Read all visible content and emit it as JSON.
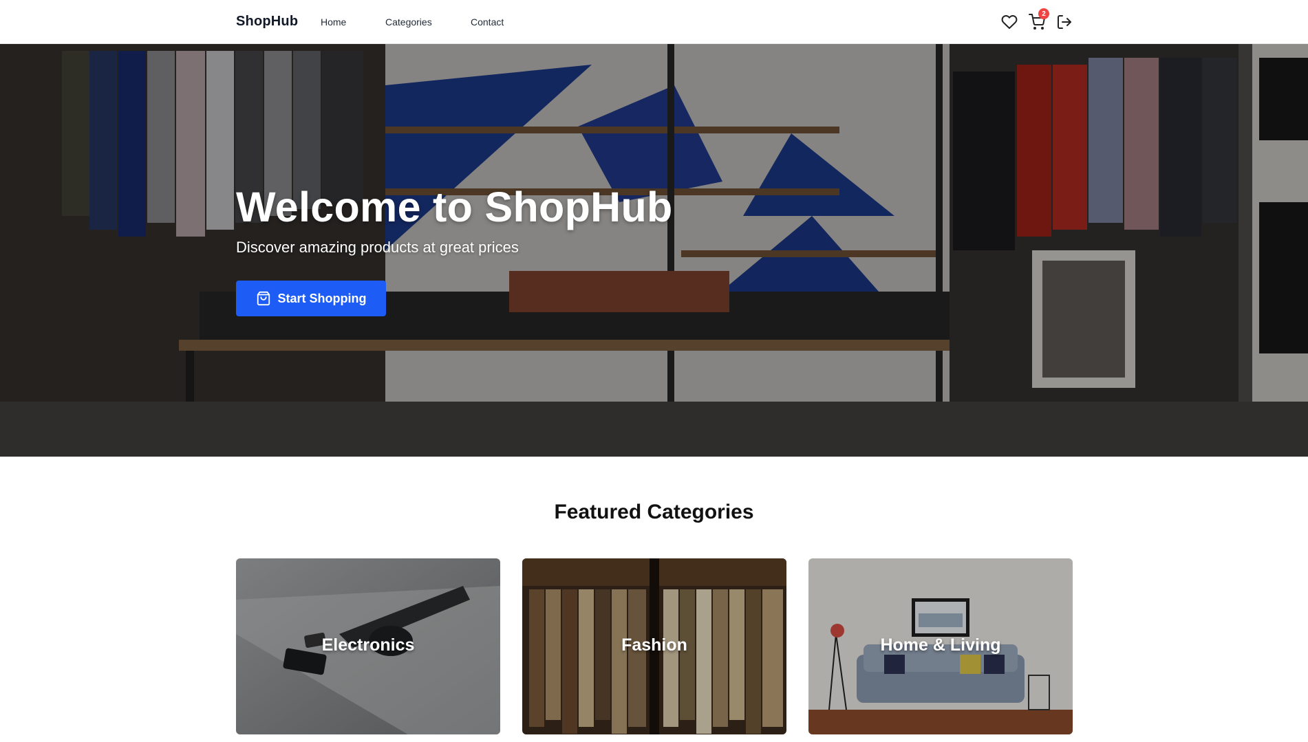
{
  "header": {
    "brand": "ShopHub",
    "nav": [
      {
        "label": "Home"
      },
      {
        "label": "Categories"
      },
      {
        "label": "Contact"
      }
    ],
    "icons": [
      "heart-icon",
      "cart-icon",
      "logout-icon"
    ],
    "cart_count": "2"
  },
  "hero": {
    "title": "Welcome to ShopHub",
    "subtitle": "Discover amazing products at great prices",
    "cta_label": "Start Shopping",
    "cta_icon": "shopping-bag-icon"
  },
  "featured": {
    "title": "Featured Categories",
    "categories": [
      {
        "label": "Electronics"
      },
      {
        "label": "Fashion"
      },
      {
        "label": "Home & Living"
      }
    ]
  },
  "colors": {
    "accent": "#1d5cf5",
    "badge": "#ef4444",
    "text": "#111111"
  }
}
